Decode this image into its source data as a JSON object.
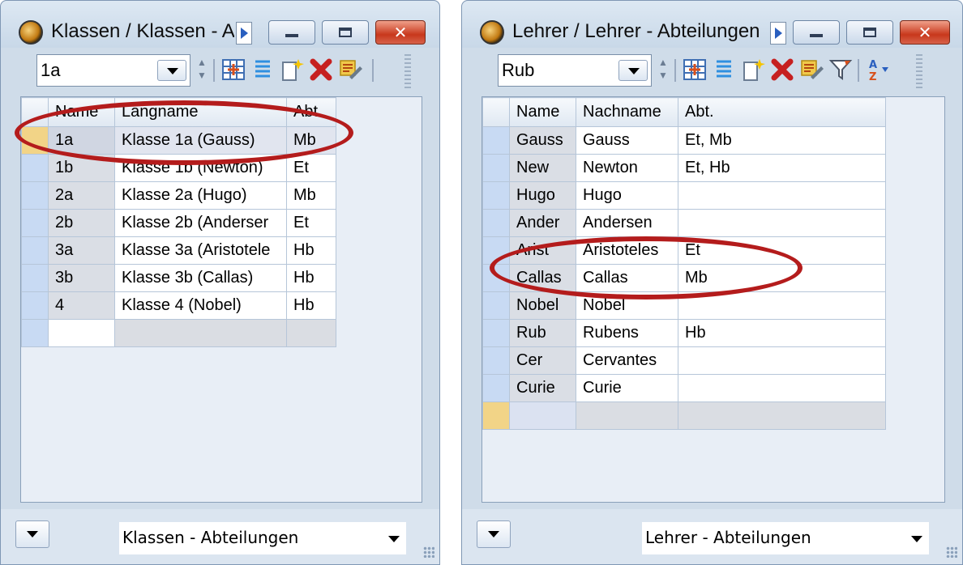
{
  "left": {
    "title": "Klassen / Klassen - A",
    "combo_value": "1a",
    "columns": [
      "Name",
      "Langname",
      "Abt."
    ],
    "rows": [
      [
        "1a",
        "Klasse 1a (Gauss)",
        "Mb"
      ],
      [
        "1b",
        "Klasse 1b (Newton)",
        "Et"
      ],
      [
        "2a",
        "Klasse 2a (Hugo)",
        "Mb"
      ],
      [
        "2b",
        "Klasse 2b (Anderser",
        "Et"
      ],
      [
        "3a",
        "Klasse 3a (Aristotele",
        "Hb"
      ],
      [
        "3b",
        "Klasse 3b (Callas)",
        "Hb"
      ],
      [
        "4",
        "Klasse 4 (Nobel)",
        "Hb"
      ]
    ],
    "view": "Klassen - Abteilungen"
  },
  "right": {
    "title": "Lehrer / Lehrer - Abteilungen",
    "combo_value": "Rub",
    "columns": [
      "Name",
      "Nachname",
      "Abt."
    ],
    "rows": [
      [
        "Gauss",
        "Gauss",
        "Et, Mb"
      ],
      [
        "New",
        "Newton",
        "Et, Hb"
      ],
      [
        "Hugo",
        "Hugo",
        ""
      ],
      [
        "Ander",
        "Andersen",
        ""
      ],
      [
        "Arist",
        "Aristoteles",
        "Et"
      ],
      [
        "Callas",
        "Callas",
        "Mb"
      ],
      [
        "Nobel",
        "Nobel",
        ""
      ],
      [
        "Rub",
        "Rubens",
        "Hb"
      ],
      [
        "Cer",
        "Cervantes",
        ""
      ],
      [
        "Curie",
        "Curie",
        ""
      ]
    ],
    "view": "Lehrer - Abteilungen"
  },
  "icons": [
    "clock-app-icon",
    "play-arrow-icon",
    "minimize-icon",
    "maximize-icon",
    "close-icon",
    "grid-icon",
    "list-icon",
    "new-record-icon",
    "delete-icon",
    "edit-icon",
    "filter-icon",
    "sort-icon"
  ],
  "colors": {
    "annotation": "#b41c1c",
    "current_row": "#f2d487",
    "row_indicator": "#c8daf3"
  }
}
